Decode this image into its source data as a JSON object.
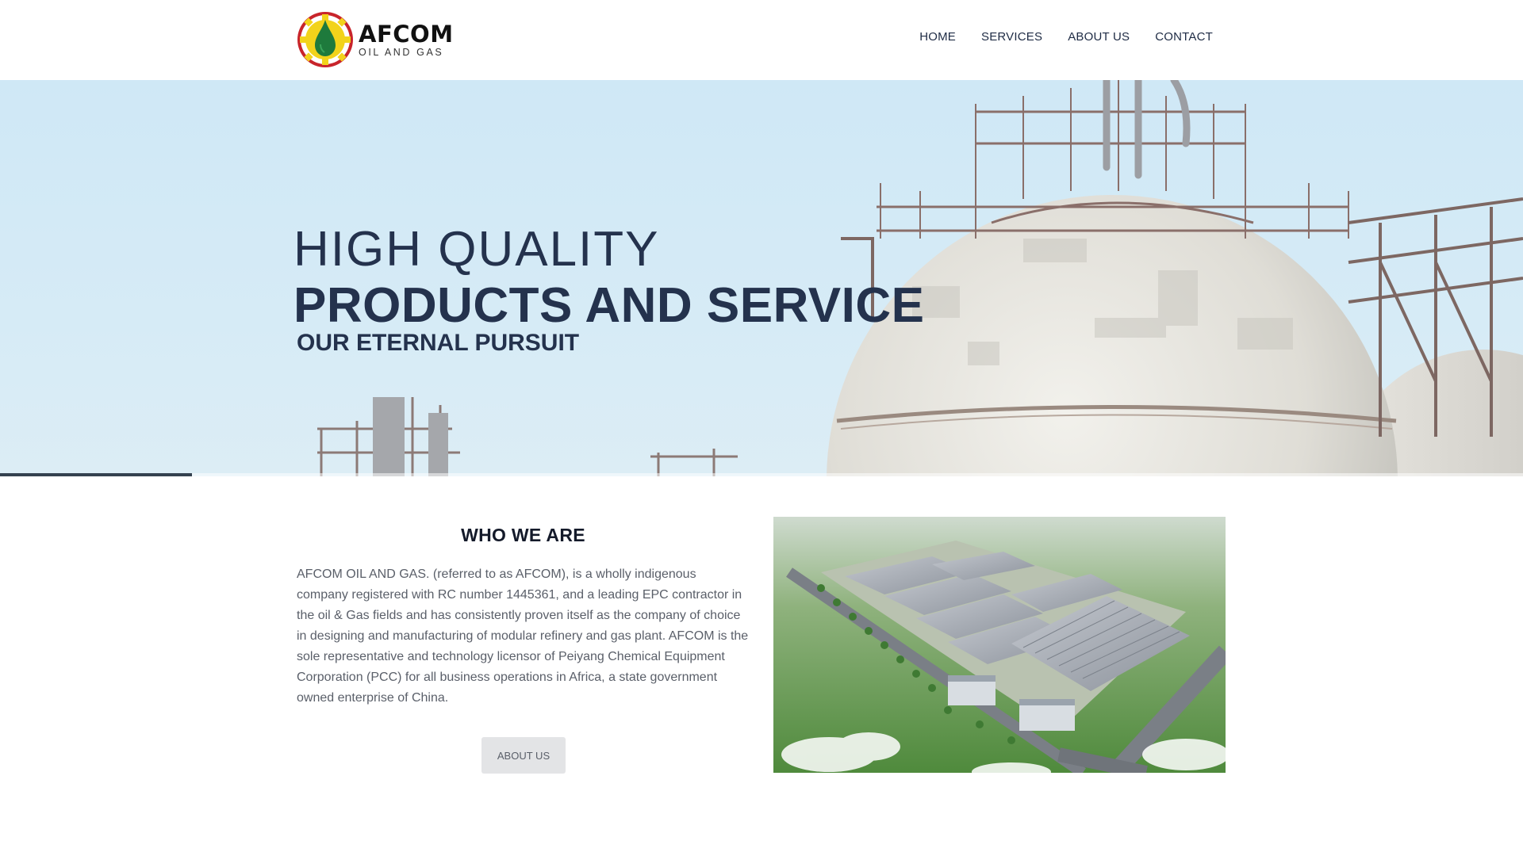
{
  "brand": {
    "name": "AFCOM",
    "tagline": "OIL AND GAS",
    "colors": {
      "ring": "#c8242b",
      "gear": "#f2d31b",
      "drop": "#1e7a3c"
    }
  },
  "nav": {
    "items": [
      {
        "label": "HOME"
      },
      {
        "label": "SERVICES"
      },
      {
        "label": "ABOUT US"
      },
      {
        "label": "CONTACT"
      }
    ]
  },
  "hero": {
    "line1": "HIGH QUALITY",
    "line2": "PRODUCTS AND SERVICE",
    "line3": "OUR ETERNAL PURSUIT",
    "slider_progress": 0.126,
    "text_color": "#24324d"
  },
  "about": {
    "title": "WHO WE ARE",
    "body": "AFCOM OIL AND GAS. (referred to as AFCOM), is a wholly indigenous company registered with RC number 1445361, and a leading EPC contractor in the oil & Gas fields and has consistently proven itself as the company of choice in designing and manufacturing of modular refinery and gas plant. AFCOM is the sole representative and technology licensor of Peiyang Chemical Equipment Corporation (PCC) for all business operations in Africa, a state government owned enterprise of China.",
    "button_label": "ABOUT US"
  }
}
